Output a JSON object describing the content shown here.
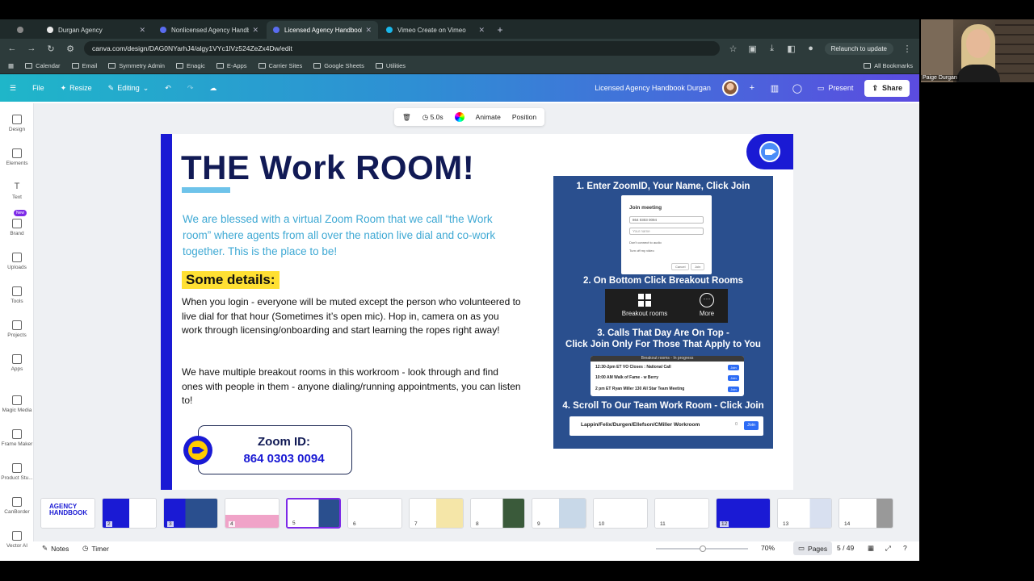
{
  "browser": {
    "tabs": [
      {
        "title": "Durgan Agency",
        "active": false
      },
      {
        "title": "Nonlicensed Agency Handboo",
        "active": false
      },
      {
        "title": "Licensed Agency Handbook",
        "active": true
      },
      {
        "title": "Vimeo Create on Vimeo",
        "active": false
      }
    ],
    "url": "canva.com/design/DAG0NYarhJ4/algy1VYc1lVz524ZeZx4Dw/edit",
    "relaunch_label": "Relaunch to update",
    "bookmarks": [
      "Calendar",
      "Email",
      "Symmetry Admin",
      "Enagic",
      "E-Apps",
      "Carrier Sites",
      "Google Sheets",
      "Utilities"
    ],
    "all_bookmarks": "All Bookmarks"
  },
  "canva": {
    "file": "File",
    "resize": "Resize",
    "editing": "Editing",
    "doc_title": "Licensed Agency Handbook Durgan",
    "present": "Present",
    "share": "Share",
    "notification_count": "1"
  },
  "leftnav": [
    {
      "label": "Design"
    },
    {
      "label": "Elements"
    },
    {
      "label": "Text"
    },
    {
      "label": "Brand"
    },
    {
      "label": "Uploads"
    },
    {
      "label": "Tools"
    },
    {
      "label": "Projects"
    },
    {
      "label": "Apps"
    },
    {
      "label": "Magic Media"
    },
    {
      "label": "Frame Maker"
    },
    {
      "label": "Product Stu..."
    },
    {
      "label": "CanBorder"
    },
    {
      "label": "Vector AI"
    }
  ],
  "leftnav_new_badge": "New",
  "toolbar": {
    "duration": "5.0s",
    "animate": "Animate",
    "position": "Position"
  },
  "slide": {
    "title": "THE Work ROOM!",
    "blessed": "We are blessed with a virtual Zoom Room that we call “the Work room” where agents from all over the nation live dial and co-work together. This is the place to be!",
    "details_heading": "Some details:",
    "para1": "When you login - everyone will be muted except the person who volunteered to live dial for that hour (Sometimes it’s open mic). Hop in, camera on as you work through licensing/onboarding and start learning the ropes right away!",
    "para2": "We have multiple breakout rooms in this workroom - look through and find ones with people in them - anyone dialing/running appointments, you can listen to!",
    "zoom_id_label": "Zoom ID:",
    "zoom_id_number": "864 0303 0094",
    "step1": "1. Enter ZoomID, Your Name, Click Join",
    "step2": "2. On Bottom Click Breakout Rooms",
    "step3a": "3. Calls That Day Are On Top -",
    "step3b": "Click Join Only For Those That Apply to You",
    "step4": "4. Scroll To Our Team Work Room - Click Join",
    "join_meeting": {
      "title": "Join meeting",
      "id_value": "864 0303 0094",
      "name_placeholder": "Your name",
      "opt1": "Don't connect to audio",
      "opt2": "Turn off my video",
      "cancel": "Cancel",
      "join": "Join"
    },
    "breakout_bar": {
      "breakout": "Breakout rooms",
      "more": "More"
    },
    "rooms": {
      "header": "Breakout rooms - In progress",
      "rows": [
        "12:30-2pm ET VO Closes : National Call",
        "10:00 AM Walk of Fame - w Berry",
        "2 pm ET Ryan Miller 130 All Star Team Meeting"
      ],
      "join": "Join"
    },
    "team_room": {
      "name": "Lappin/Felix/Durgen/Ellefson/CMiller Workroom",
      "count": "0",
      "join": "Join"
    }
  },
  "filmstrip": {
    "pages": [
      "",
      "2",
      "3",
      "4",
      "5",
      "6",
      "7",
      "8",
      "9",
      "10",
      "11",
      "12",
      "13",
      "14"
    ],
    "selected_index": 4,
    "first_thumb_text": "AGENCY HANDBOOK"
  },
  "bottombar": {
    "notes": "Notes",
    "timer": "Timer",
    "zoom": "70%",
    "pages": "Pages",
    "page_count": "5 / 49"
  },
  "webcam": {
    "name": "Paige Durgan"
  }
}
